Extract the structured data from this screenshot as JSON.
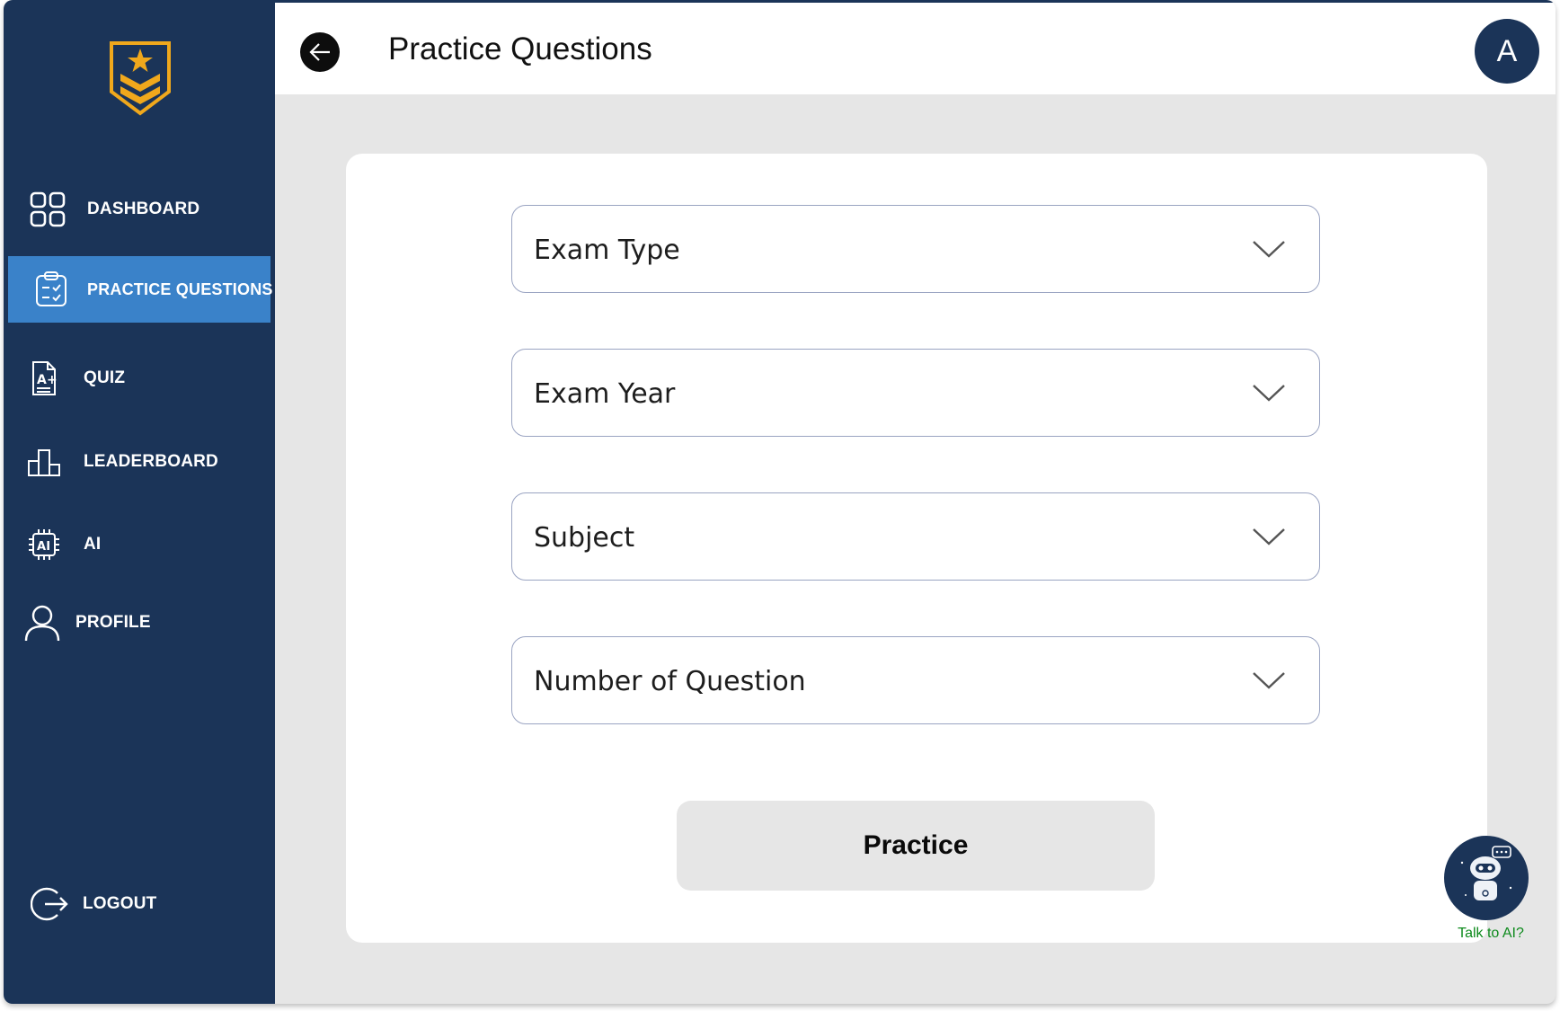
{
  "sidebar": {
    "items": [
      {
        "label": "DASHBOARD",
        "icon": "grid-icon"
      },
      {
        "label": "PRACTICE QUESTIONS",
        "icon": "clipboard-check-icon",
        "active": true
      },
      {
        "label": "QUIZ",
        "icon": "document-grade-icon"
      },
      {
        "label": "LEADERBOARD",
        "icon": "podium-icon"
      },
      {
        "label": "AI",
        "icon": "ai-chip-icon"
      },
      {
        "label": "PROFILE",
        "icon": "user-icon"
      }
    ],
    "logout_label": "LOGOUT"
  },
  "header": {
    "title": "Practice Questions",
    "avatar_initial": "A"
  },
  "form": {
    "selects": [
      {
        "label": "Exam Type"
      },
      {
        "label": "Exam Year"
      },
      {
        "label": "Subject"
      },
      {
        "label": "Number of Question"
      }
    ],
    "submit_label": "Practice"
  },
  "assistant": {
    "caption": "Talk to AI?"
  },
  "colors": {
    "sidebar_bg": "#1b3458",
    "active_item": "#3a82c9",
    "logo_gold": "#f0a81c",
    "caption_green": "#0d8a1c"
  }
}
